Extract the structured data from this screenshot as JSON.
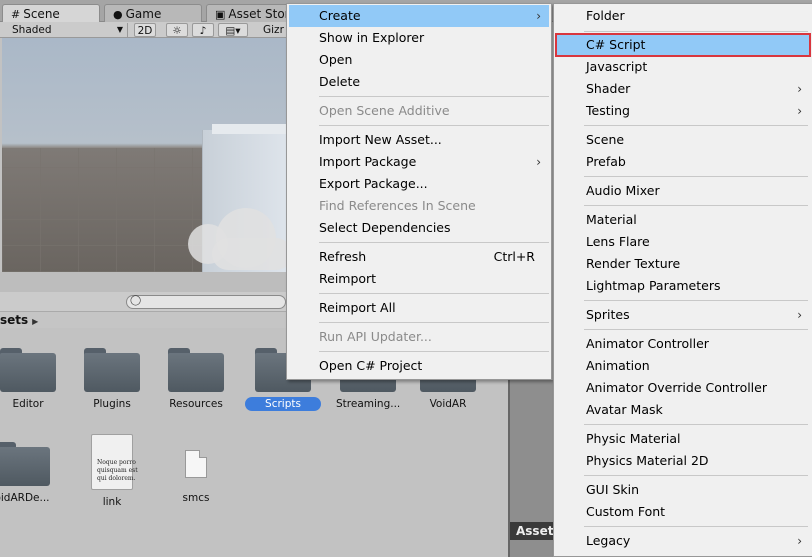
{
  "tabs": [
    {
      "label": "Scene",
      "icon": "hash-grid-icon"
    },
    {
      "label": "Game",
      "icon": "pacman-icon"
    },
    {
      "label": "Asset Store",
      "icon": "bag-icon"
    }
  ],
  "scene_toolbar": {
    "shading_mode": "Shaded",
    "mode_2d": "2D",
    "gizmos_label": "Gizr"
  },
  "breadcrumb": "sets",
  "inspector_tab": "Asset",
  "assets": [
    {
      "label": "Editor",
      "kind": "folder"
    },
    {
      "label": "Plugins",
      "kind": "folder"
    },
    {
      "label": "Resources",
      "kind": "folder"
    },
    {
      "label": "Scripts",
      "kind": "folder",
      "selected": true
    },
    {
      "label": "Streaming...",
      "kind": "folder"
    },
    {
      "label": "VoidAR",
      "kind": "folder"
    },
    {
      "label": "oidARDe...",
      "kind": "folder"
    },
    {
      "label": "link",
      "kind": "document",
      "preview": [
        "Noque porro",
        "quisquam est",
        "qui dolorem."
      ]
    },
    {
      "label": "smcs",
      "kind": "file"
    }
  ],
  "context_menu": [
    {
      "label": "Create",
      "submenu": true,
      "highlighted": true
    },
    {
      "label": "Show in Explorer"
    },
    {
      "label": "Open"
    },
    {
      "label": "Delete"
    },
    {
      "label": "Open Scene Additive",
      "disabled": true
    },
    {
      "label": "Import New Asset..."
    },
    {
      "label": "Import Package",
      "submenu": true
    },
    {
      "label": "Export Package..."
    },
    {
      "label": "Find References In Scene",
      "disabled": true
    },
    {
      "label": "Select Dependencies"
    },
    {
      "label": "Refresh",
      "shortcut": "Ctrl+R"
    },
    {
      "label": "Reimport"
    },
    {
      "label": "Reimport All"
    },
    {
      "label": "Run API Updater...",
      "disabled": true
    },
    {
      "label": "Open C# Project"
    }
  ],
  "create_submenu": [
    {
      "label": "Folder"
    },
    {
      "label": "C# Script",
      "highlighted": true,
      "boxed": true
    },
    {
      "label": "Javascript"
    },
    {
      "label": "Shader",
      "submenu": true
    },
    {
      "label": "Testing",
      "submenu": true
    },
    {
      "label": "Scene"
    },
    {
      "label": "Prefab"
    },
    {
      "label": "Audio Mixer"
    },
    {
      "label": "Material"
    },
    {
      "label": "Lens Flare"
    },
    {
      "label": "Render Texture"
    },
    {
      "label": "Lightmap Parameters"
    },
    {
      "label": "Sprites",
      "submenu": true
    },
    {
      "label": "Animator Controller"
    },
    {
      "label": "Animation"
    },
    {
      "label": "Animator Override Controller"
    },
    {
      "label": "Avatar Mask"
    },
    {
      "label": "Physic Material"
    },
    {
      "label": "Physics Material 2D"
    },
    {
      "label": "GUI Skin"
    },
    {
      "label": "Custom Font"
    },
    {
      "label": "Legacy",
      "submenu": true
    }
  ],
  "colors": {
    "menu_highlight": "#91c9f7",
    "callout_box": "#d9363e",
    "selection": "#3d7ddc"
  }
}
